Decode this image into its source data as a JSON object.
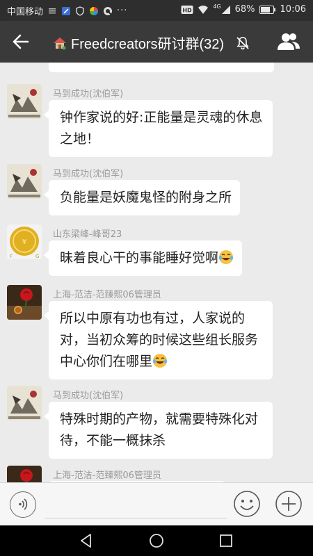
{
  "status": {
    "carrier": "中国移动",
    "battery": "68%",
    "time": "10:06",
    "network": "4G"
  },
  "header": {
    "title": "Freedcreators研讨群(32)",
    "icons": [
      "back-arrow-icon",
      "house-emoji-icon",
      "mute-icon",
      "group-members-icon"
    ]
  },
  "messages": [
    {
      "sender": "马到成功(沈伯军)",
      "text_lines": [
        "钟作家说的好:正能量是灵魂的休息",
        "之地！"
      ],
      "avatar": "painting-avatar"
    },
    {
      "sender": "马到成功(沈伯军)",
      "text_lines": [
        "负能量是妖魔鬼怪的附身之所"
      ],
      "avatar": "painting-avatar"
    },
    {
      "sender": "山东梁峰-峰哥23",
      "text_lines": [
        "昧着良心干的事能睡好觉啊"
      ],
      "avatar": "gold-coin-avatar",
      "emoji": "laughing-tears-emoji"
    },
    {
      "sender": "上海-范洁-范臻熙06管理员",
      "text_lines": [
        "所以中原有功也有过，人家说的",
        "对，当初众筹的时候这些组长服务",
        "中心你们在哪里"
      ],
      "avatar": "rose-avatar",
      "emoji": "laughing-tears-emoji"
    },
    {
      "sender": "马到成功(沈伯军)",
      "text_lines": [
        "特殊时期的产物，就需要特殊化对",
        "待，不能一概抹杀"
      ],
      "avatar": "painting-avatar"
    },
    {
      "sender": "上海-范洁-范臻熙06管理员",
      "text_lines": [],
      "avatar": "rose-avatar"
    }
  ],
  "colors": {
    "status_bar": "#2e2e2e",
    "title_bar": "#3a3a3a",
    "chat_bg": "#ebebeb",
    "bubble": "#ffffff",
    "nav_bar": "#000000"
  }
}
